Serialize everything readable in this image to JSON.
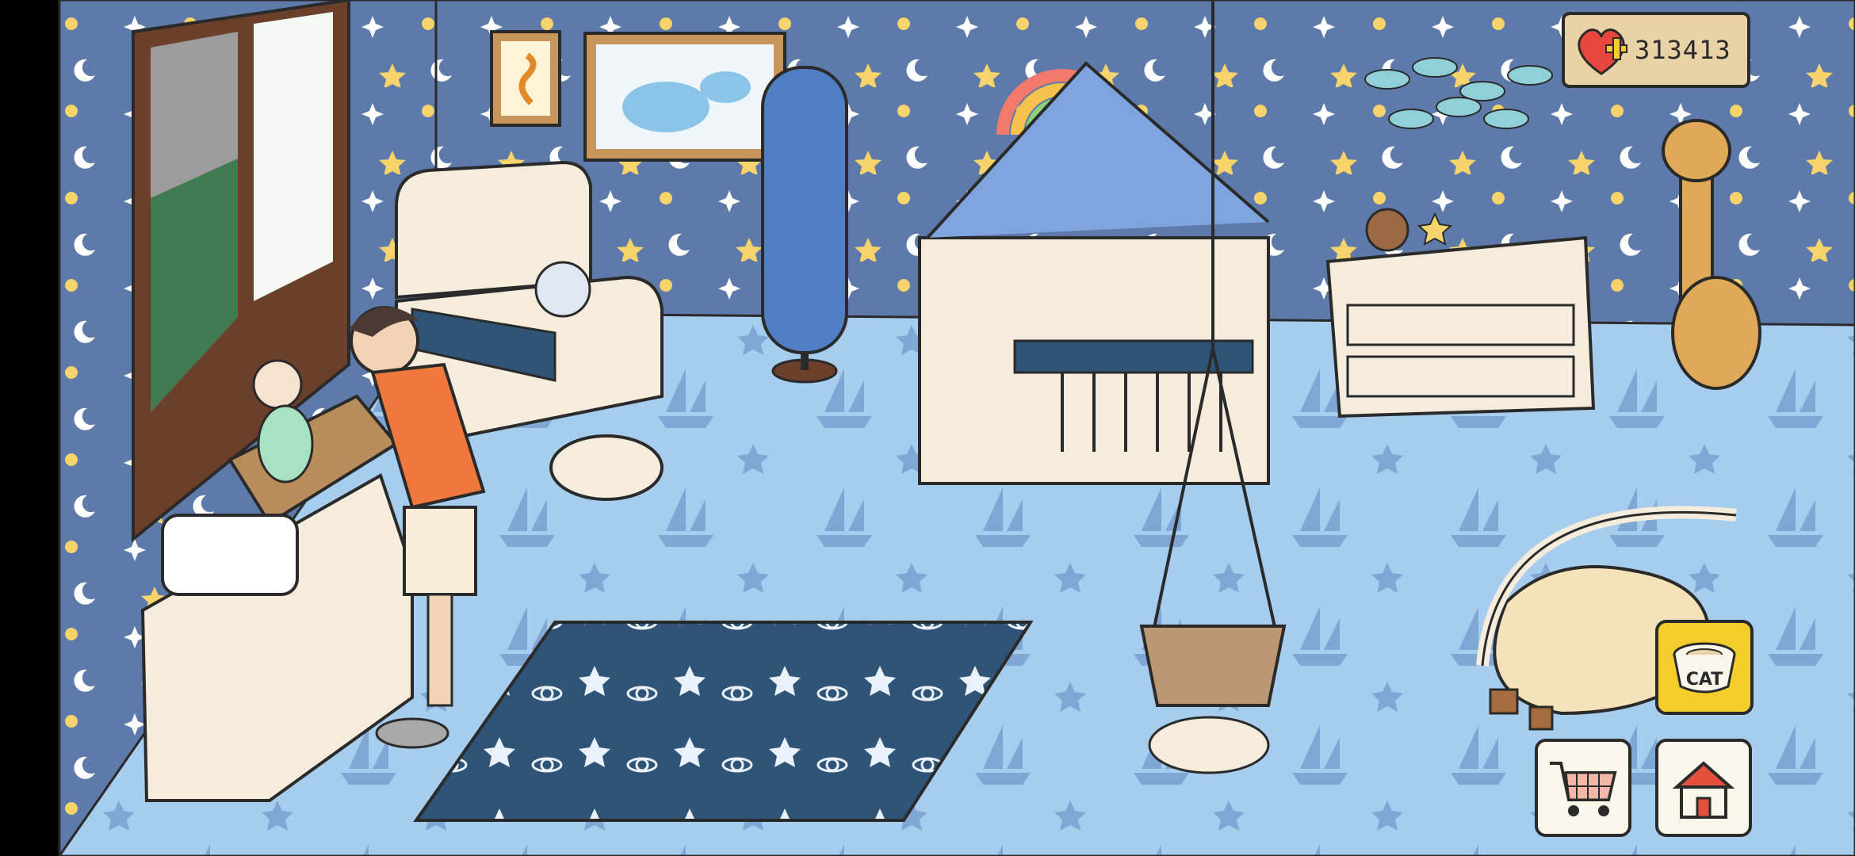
{
  "hud": {
    "currency_value": "313413",
    "currency_icon": "heart-plus-icon",
    "cat_button_label": "CAT",
    "cat_button_icon": "cat-bowl-icon",
    "shop_button_icon": "shopping-cart-icon",
    "home_button_icon": "house-icon"
  },
  "colors": {
    "wall": "#5d7aaa",
    "floor": "#a6cdee",
    "rug": "#2f5478",
    "cat_button": "#f4cd2d",
    "currency_plaque": "#e9d3a6",
    "outline": "#2a2a2a"
  }
}
